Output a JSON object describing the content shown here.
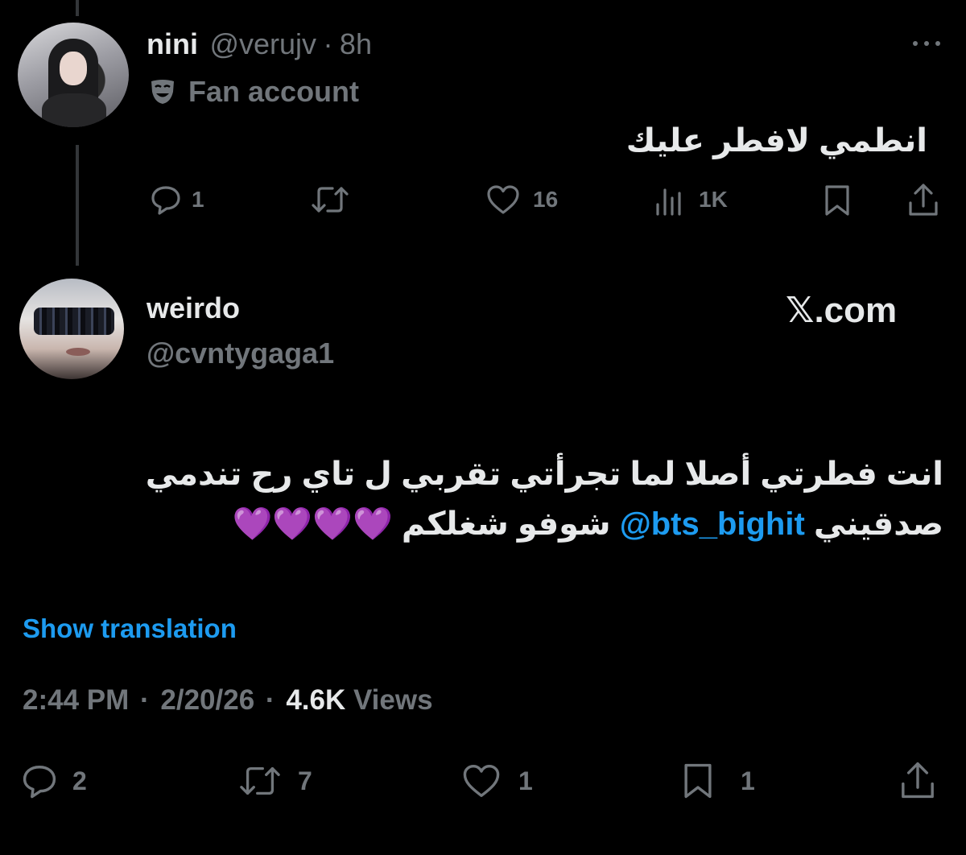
{
  "parent_tweet": {
    "display_name": "nini",
    "handle": "@verujv",
    "separator": "·",
    "time": "8h",
    "badge_icon": "performing-arts-mask-icon",
    "badge_text": "Fan account",
    "more_icon": "more-dots-icon",
    "text": "انطمي لافطر عليك",
    "actions": {
      "reply_count": "1",
      "retweet_count": "",
      "like_count": "16",
      "views_count": "1K"
    }
  },
  "main_tweet": {
    "display_name": "weirdo",
    "handle": "@cvntygaga1",
    "watermark": "𝕏.com",
    "text_line1": "انت فطرتي أصلا لما تجرأتي تقربي ل تاي رح تندمي",
    "text_line2_start": "صدقيني ",
    "mention": "@bts_bighit",
    "text_line2_end": " شوفو شغلكم ",
    "emoji": "💜💜💜💜",
    "show_translation": "Show translation",
    "meta": {
      "time": "2:44 PM",
      "dot1": "·",
      "date": "2/20/26",
      "dot2": "·",
      "views_count": "4.6K",
      "views_label": " Views"
    },
    "actions": {
      "reply_count": "2",
      "retweet_count": "7",
      "like_count": "1",
      "bookmark_count": "1"
    }
  },
  "colors": {
    "background": "#000000",
    "text": "#e7e9ea",
    "muted": "#71767b",
    "link": "#1d9bf0"
  }
}
